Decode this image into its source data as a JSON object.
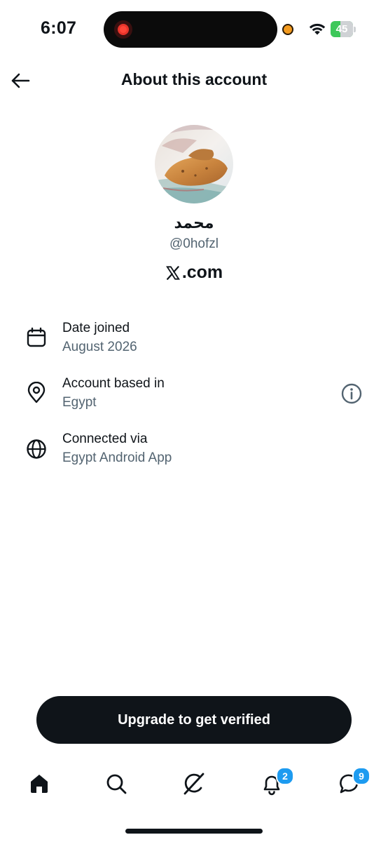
{
  "status_bar": {
    "time": "6:07",
    "battery_percent": "45",
    "battery_level": 0.45,
    "recording_color": "#ff4538",
    "mic_indicator_color": "#f39a1e"
  },
  "header": {
    "title": "About this account",
    "back_icon": "arrow-left-icon"
  },
  "profile": {
    "display_name": "محمد",
    "handle": "@0hofzl",
    "brand_text": ".com",
    "brand_icon": "x-logo-icon",
    "avatar_icon": "profile-photo-avatar"
  },
  "info_rows": [
    {
      "icon": "calendar-icon",
      "label": "Date joined",
      "value": "August 2026"
    },
    {
      "icon": "location-pin-icon",
      "label": "Account based in",
      "value": "Egypt"
    },
    {
      "icon": "globe-icon",
      "label": "Connected via",
      "value": "Egypt Android App"
    }
  ],
  "info_button_icon": "info-circle-icon",
  "upgrade_button": {
    "label": "Upgrade to get verified"
  },
  "bottom_nav": {
    "items": [
      {
        "icon": "home-icon"
      },
      {
        "icon": "search-icon"
      },
      {
        "icon": "grok-icon"
      },
      {
        "icon": "bell-icon",
        "badge": "2"
      },
      {
        "icon": "chat-bubble-icon",
        "badge": "9"
      }
    ],
    "badge_color": "#1d9bf0"
  },
  "colors": {
    "text_primary": "#0f1419",
    "text_secondary": "#536471",
    "button_bg": "#0f1419"
  }
}
